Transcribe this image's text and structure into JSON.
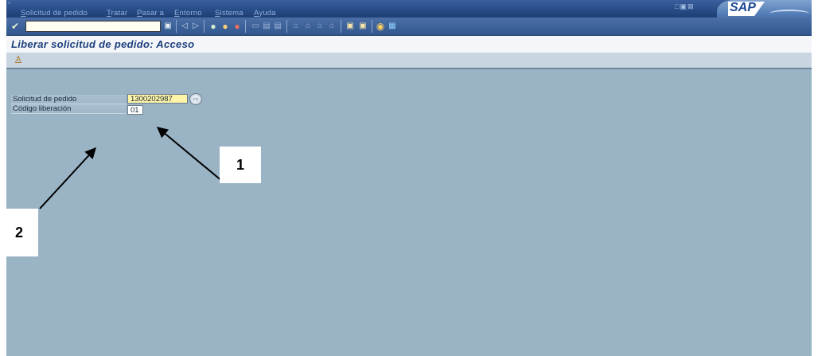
{
  "menu": [
    "Solicitud de pedido",
    "Tratar",
    "Pasar a",
    "Entorno",
    "Sistema",
    "Ayuda"
  ],
  "brand": "SAP",
  "screen_title": "Liberar solicitud de pedido: Acceso",
  "fields": {
    "purchase_requisition": {
      "label": "Solicitud de pedido",
      "value": "1300202987"
    },
    "release_code": {
      "label": "Código liberación",
      "value": "01"
    }
  },
  "annotations": {
    "callout1": "1",
    "callout2": "2"
  },
  "colors": {
    "menubar": "#274b86",
    "workspace": "#9ab4c6",
    "required_field": "#fff5a8",
    "title_text": "#1c3f7d"
  },
  "icons": [
    "enter-icon",
    "save-icon",
    "back-icon",
    "exit-icon",
    "cancel-icon",
    "print-icon",
    "find-icon",
    "find-next-icon",
    "first-page-icon",
    "prev-page-icon",
    "next-page-icon",
    "last-page-icon",
    "new-session-icon",
    "shortcut-icon",
    "help-icon",
    "layout-icon",
    "execute-icon",
    "value-help-icon"
  ]
}
